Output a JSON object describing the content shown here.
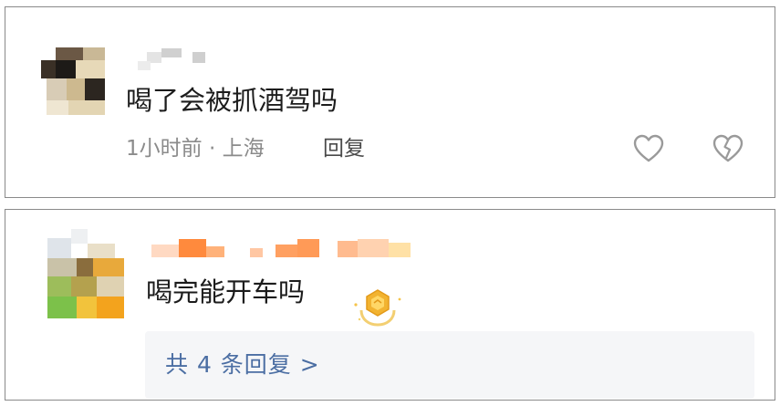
{
  "comments": [
    {
      "text": "喝了会被抓酒驾吗",
      "meta": "1小时前 · 上海",
      "reply_label": "回复"
    },
    {
      "text": "喝完能开车吗",
      "replies_summary": "共 4 条回复 >"
    }
  ],
  "icons": {
    "like": "heart-outline",
    "dislike": "broken-heart-outline",
    "badge": "gold-crown-badge"
  },
  "colors": {
    "meta_text": "#8b8b8b",
    "reply_link": "#4b6ea3",
    "reply_box_bg": "#f5f6f8",
    "badge_gold": "#f2b330"
  }
}
